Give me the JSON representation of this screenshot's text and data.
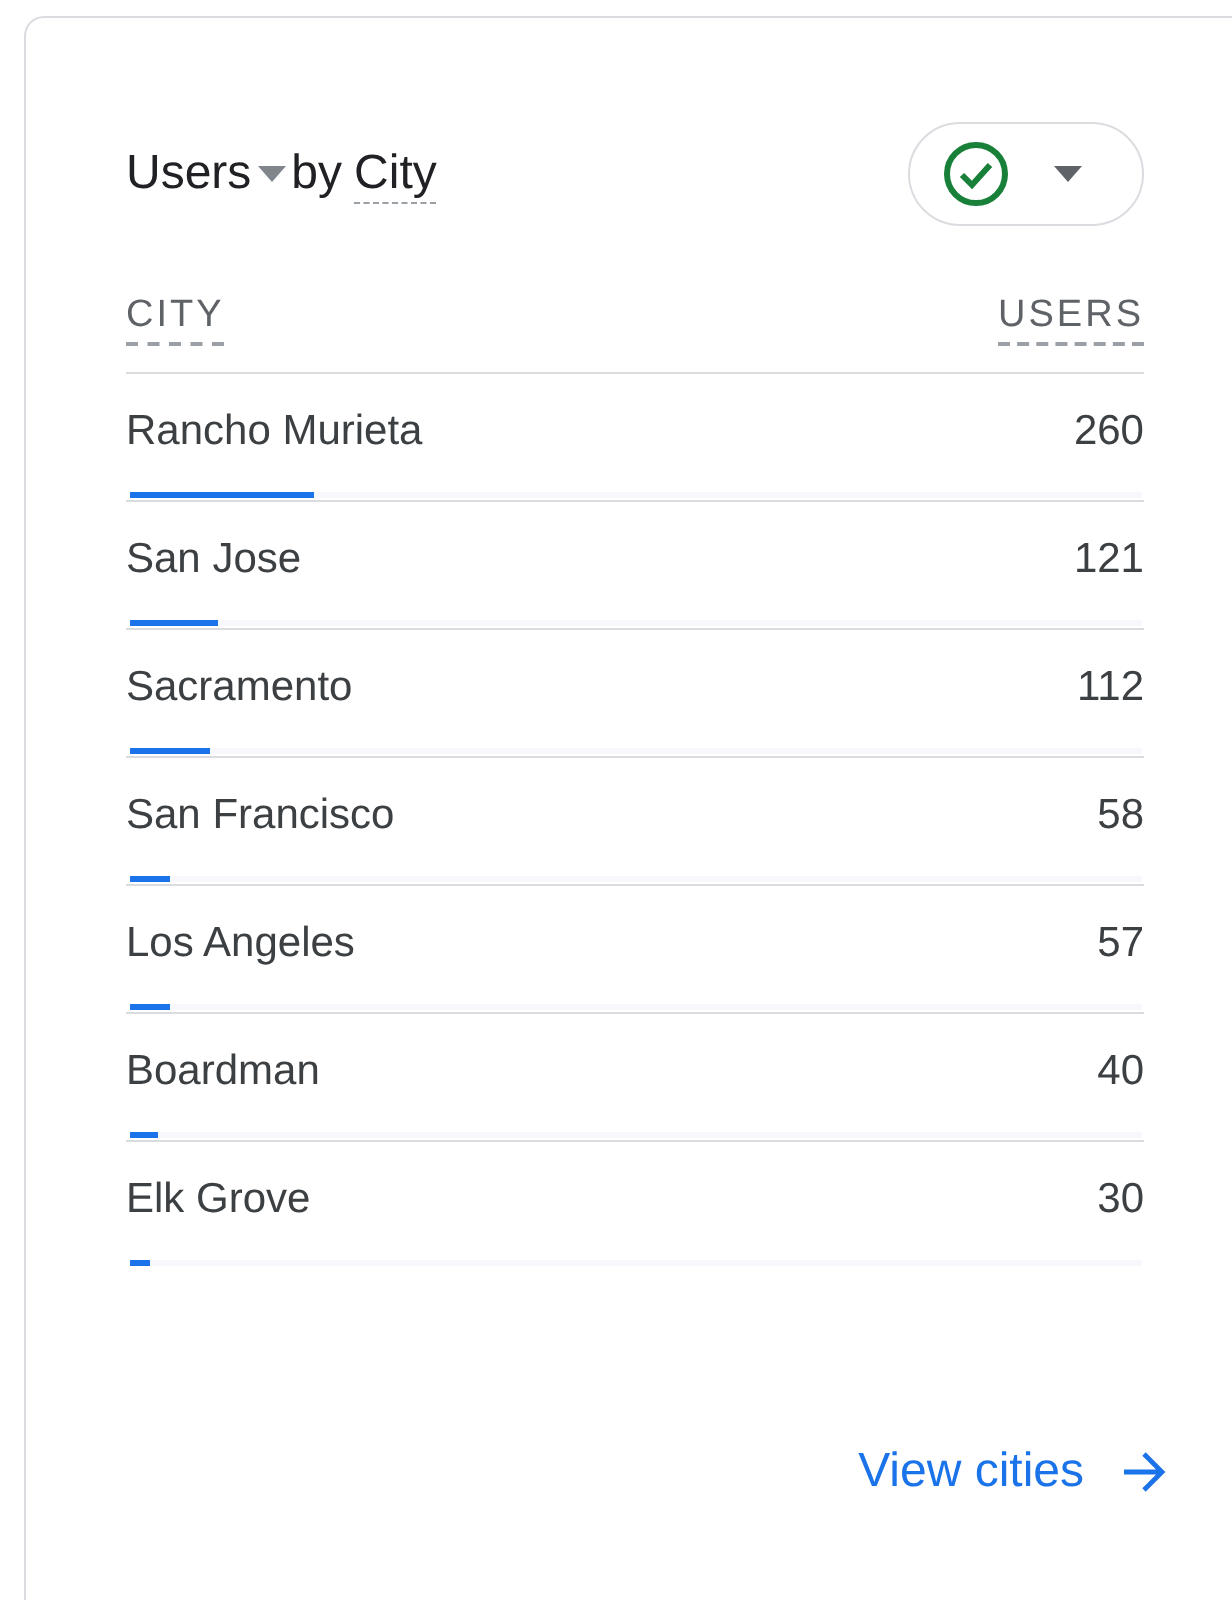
{
  "title": {
    "metric": "Users",
    "connector": "by",
    "dimension": "City"
  },
  "filter": {
    "valid": true
  },
  "columns": [
    "CITY",
    "USERS"
  ],
  "rows": [
    {
      "city": "Rancho Murieta",
      "users": "260",
      "level": 0.181
    },
    {
      "city": "San Jose",
      "users": "121",
      "level": 0.087
    },
    {
      "city": "Sacramento",
      "users": "112",
      "level": 0.079
    },
    {
      "city": "San Francisco",
      "users": "58",
      "level": 0.039
    },
    {
      "city": "Los Angeles",
      "users": "57",
      "level": 0.039
    },
    {
      "city": "Boardman",
      "users": "40",
      "level": 0.028
    },
    {
      "city": "Elk Grove",
      "users": "30",
      "level": 0.02
    }
  ],
  "link": {
    "label": "View cities"
  }
}
